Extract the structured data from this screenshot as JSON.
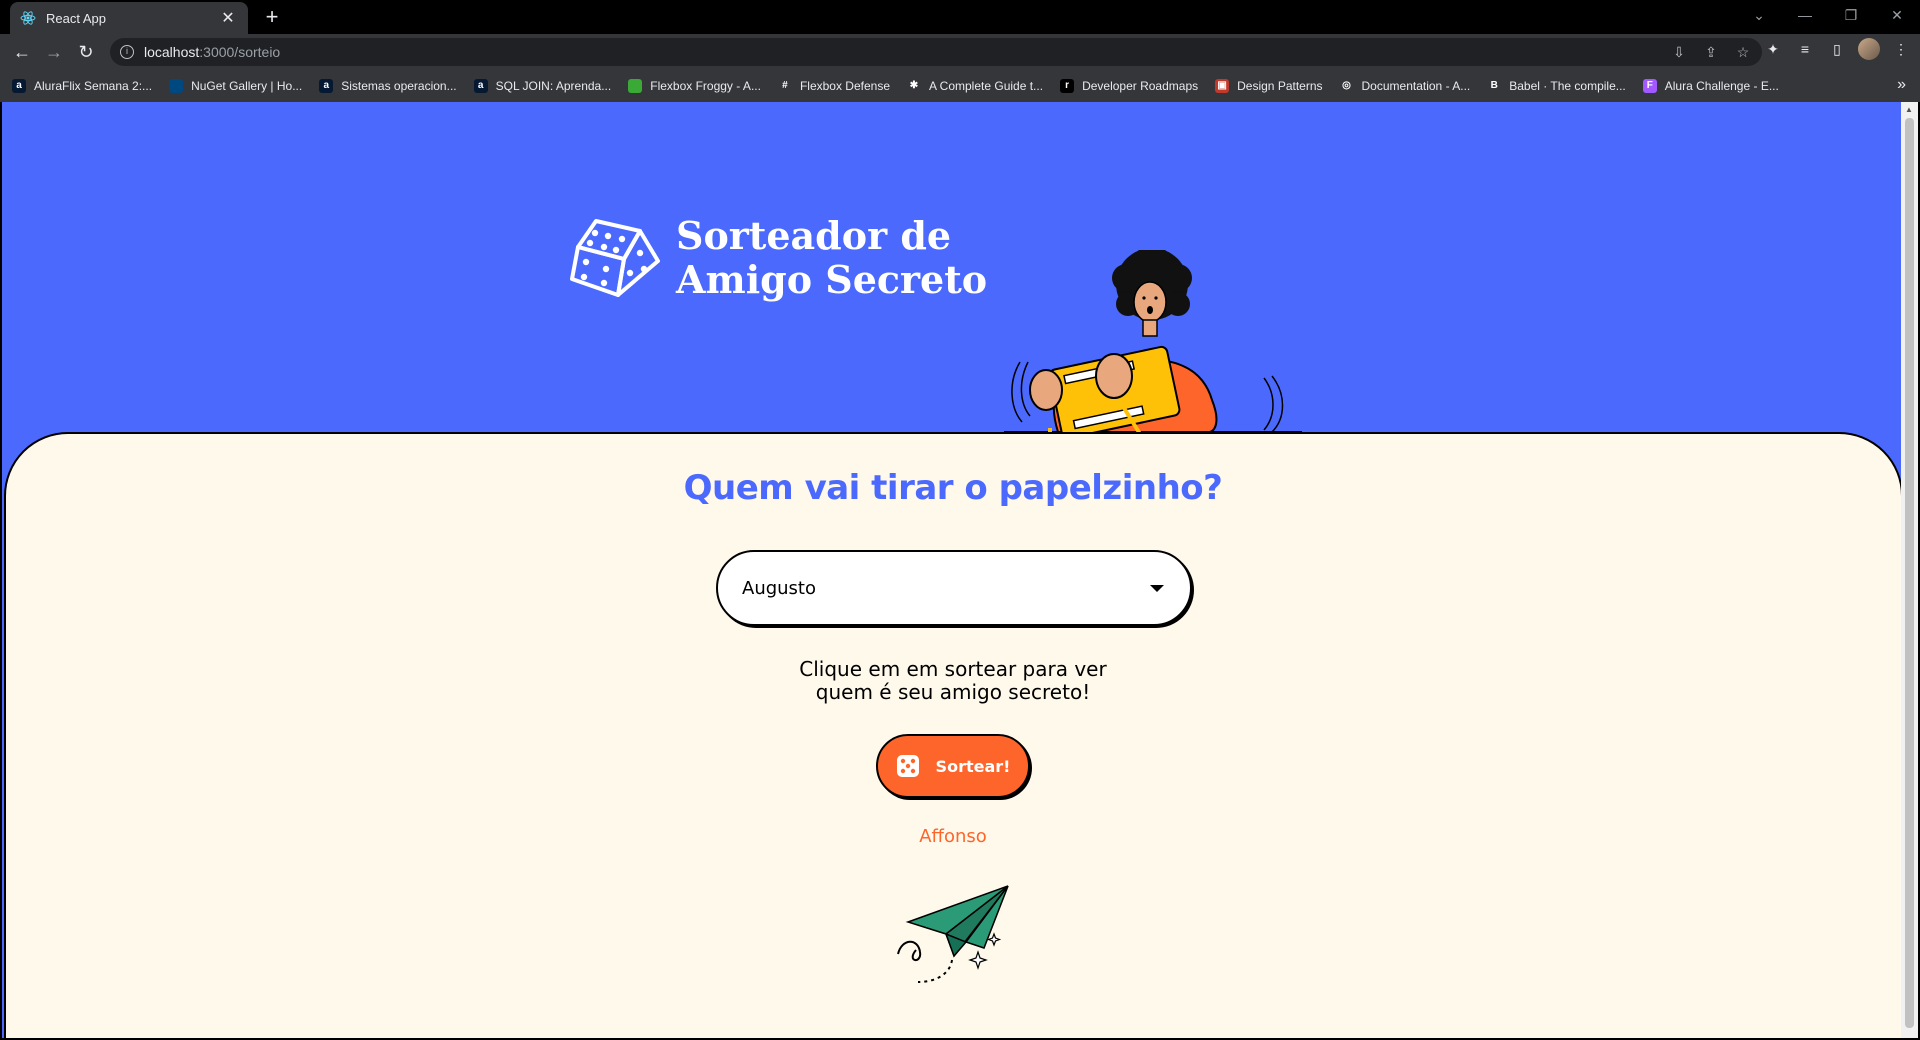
{
  "browser": {
    "tab_title": "React App",
    "url_host": "localhost",
    "url_path": ":3000/sorteio",
    "bookmarks": [
      {
        "label": "AluraFlix Semana 2:...",
        "color": "#051933",
        "glyph": "a"
      },
      {
        "label": "NuGet Gallery | Ho...",
        "color": "#004880",
        "glyph": ""
      },
      {
        "label": "Sistemas operacion...",
        "color": "#051933",
        "glyph": "a"
      },
      {
        "label": "SQL JOIN: Aprenda...",
        "color": "#051933",
        "glyph": "a"
      },
      {
        "label": "Flexbox Froggy - A...",
        "color": "#3aa935",
        "glyph": ""
      },
      {
        "label": "Flexbox Defense",
        "color": "#35363a",
        "glyph": "#"
      },
      {
        "label": "A Complete Guide t...",
        "color": "#35363a",
        "glyph": "✱"
      },
      {
        "label": "Developer Roadmaps",
        "color": "#000000",
        "glyph": "r"
      },
      {
        "label": "Design Patterns",
        "color": "#c0392b",
        "glyph": "▣"
      },
      {
        "label": "Documentation - A...",
        "color": "#35363a",
        "glyph": "◎"
      },
      {
        "label": "Babel · The compile...",
        "color": "#35363a",
        "glyph": "B"
      },
      {
        "label": "Alura Challenge - E...",
        "color": "#a259ff",
        "glyph": "F"
      }
    ]
  },
  "app": {
    "title_line1": "Sorteador de",
    "title_line2": "Amigo Secreto",
    "question": "Quem vai tirar o papelzinho?",
    "selected_participant": "Augusto",
    "hint_line1": "Clique em em sortear para ver",
    "hint_line2": "quem é seu amigo secreto!",
    "button_label": "Sortear!",
    "result": "Affonso"
  },
  "colors": {
    "primary_blue": "#4b69fd",
    "accent_orange": "#fe652b",
    "card_bg": "#fff9eb",
    "plane_green": "#2b9a77"
  }
}
